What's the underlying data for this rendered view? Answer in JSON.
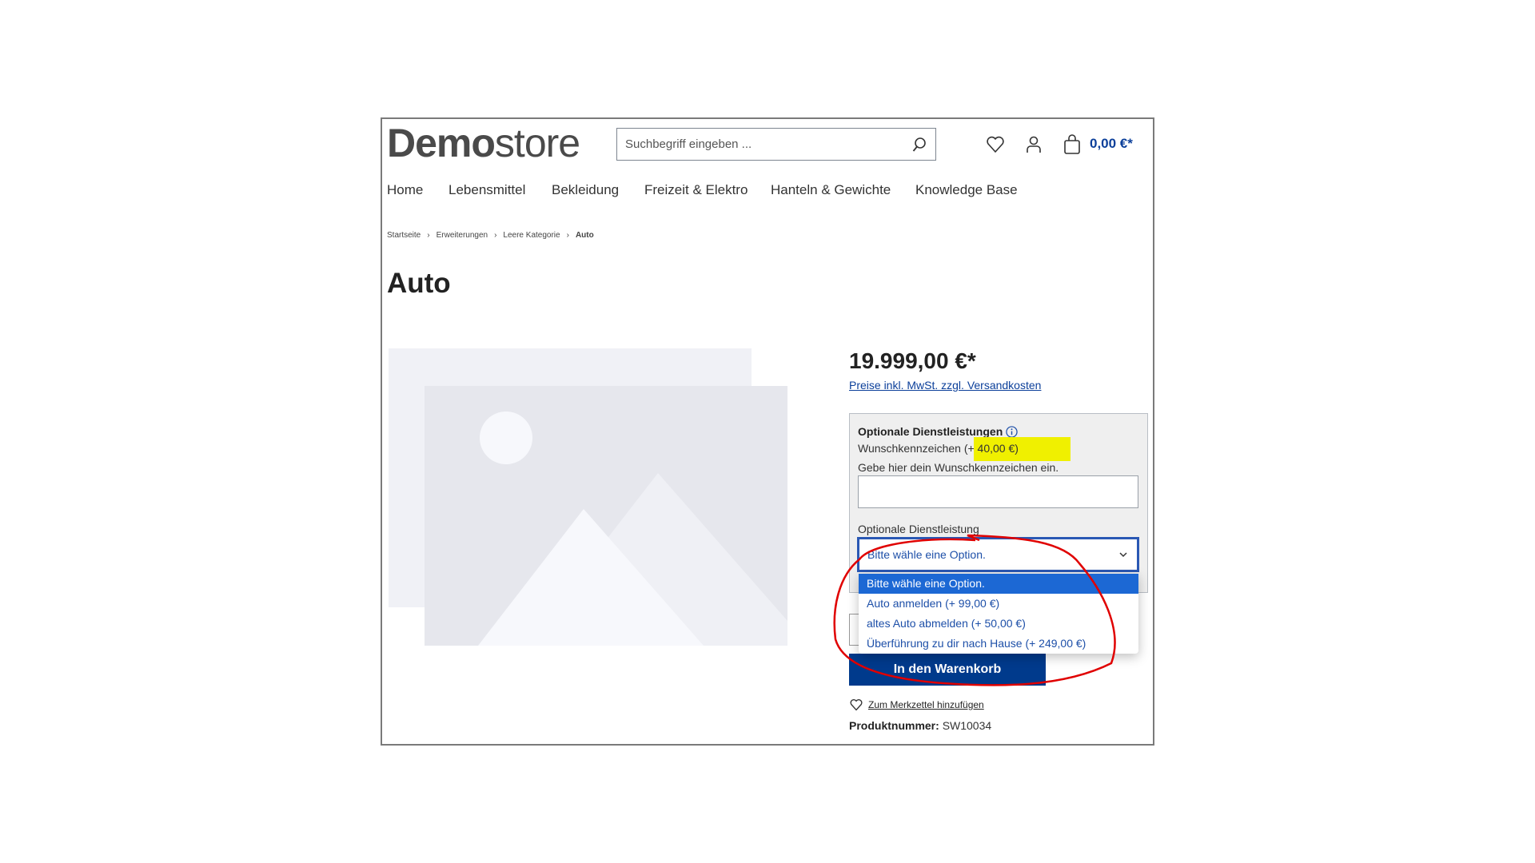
{
  "header": {
    "logo_bold": "Demo",
    "logo_light": "store",
    "search_placeholder": "Suchbegriff eingeben ...",
    "cart_total": "0,00 €*"
  },
  "nav": [
    "Home",
    "Lebensmittel",
    "Bekleidung",
    "Freizeit & Elektro",
    "Hanteln & Gewichte",
    "Knowledge Base"
  ],
  "breadcrumb": [
    "Startseite",
    "Erweiterungen",
    "Leere Kategorie",
    "Auto"
  ],
  "product": {
    "title": "Auto",
    "price": "19.999,00 €*",
    "tax_link": "Preise inkl. MwSt. zzgl. Versandkosten",
    "options_heading": "Optionale Dienstleistungen",
    "plate_label": "Wunschkennzeichen",
    "plate_price": "(+ 40,00 €)",
    "plate_hint": "Gebe hier dein Wunschkennzeichen ein.",
    "plate_value": "",
    "service_label": "Optionale Dienstleistung",
    "service_selected": "Bitte wähle eine Option.",
    "service_options": [
      "Bitte wähle eine Option.",
      "Auto anmelden (+ 99,00 €)",
      "altes Auto abmelden (+ 50,00 €)",
      "Überführung zu dir nach Hause (+ 249,00 €)"
    ],
    "cart_button": "In den Warenkorb",
    "wishlist": "Zum Merkzettel hinzufügen",
    "number_label": "Produktnummer:",
    "number": "SW10034"
  },
  "colors": {
    "brand": "#003a8c",
    "link": "#0b3f9a",
    "highlight": "#f0f000",
    "annotation": "#e00000",
    "selected_option": "#1c68d4"
  }
}
